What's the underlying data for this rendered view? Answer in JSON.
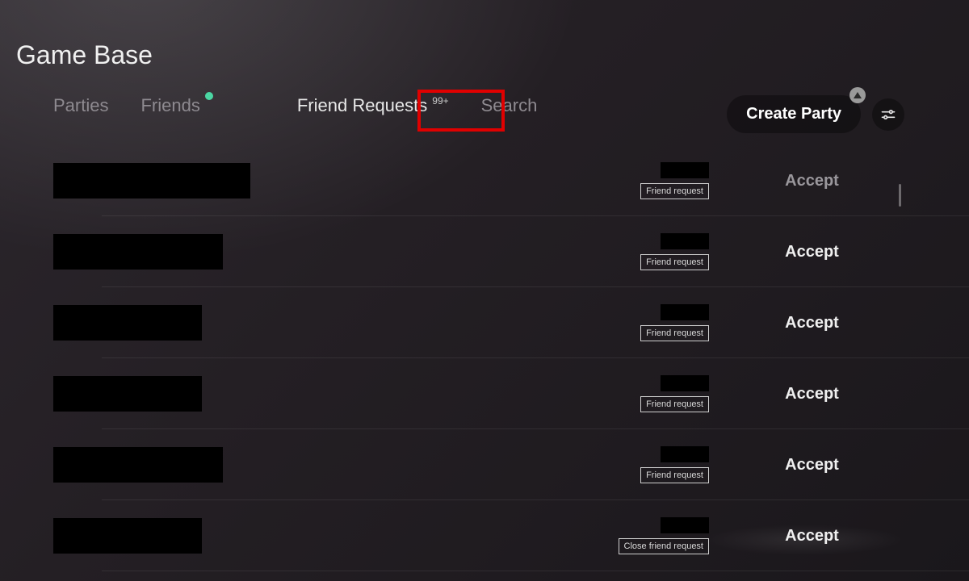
{
  "title": "Game Base",
  "tabs": {
    "parties": "Parties",
    "friends": "Friends",
    "friend_requests": "Friend Requests",
    "friend_requests_count": "99+",
    "search": "Search"
  },
  "controls": {
    "create_party": "Create Party"
  },
  "rows": [
    {
      "name_w": 244,
      "badge": "Friend request",
      "action": "Accept",
      "dim": true
    },
    {
      "name_w": 210,
      "badge": "Friend request",
      "action": "Accept",
      "dim": false
    },
    {
      "name_w": 184,
      "badge": "Friend request",
      "action": "Accept",
      "dim": false
    },
    {
      "name_w": 184,
      "badge": "Friend request",
      "action": "Accept",
      "dim": false
    },
    {
      "name_w": 210,
      "badge": "Friend request",
      "action": "Accept",
      "dim": false
    },
    {
      "name_w": 184,
      "badge": "Close friend request",
      "action": "Accept",
      "dim": false
    }
  ]
}
